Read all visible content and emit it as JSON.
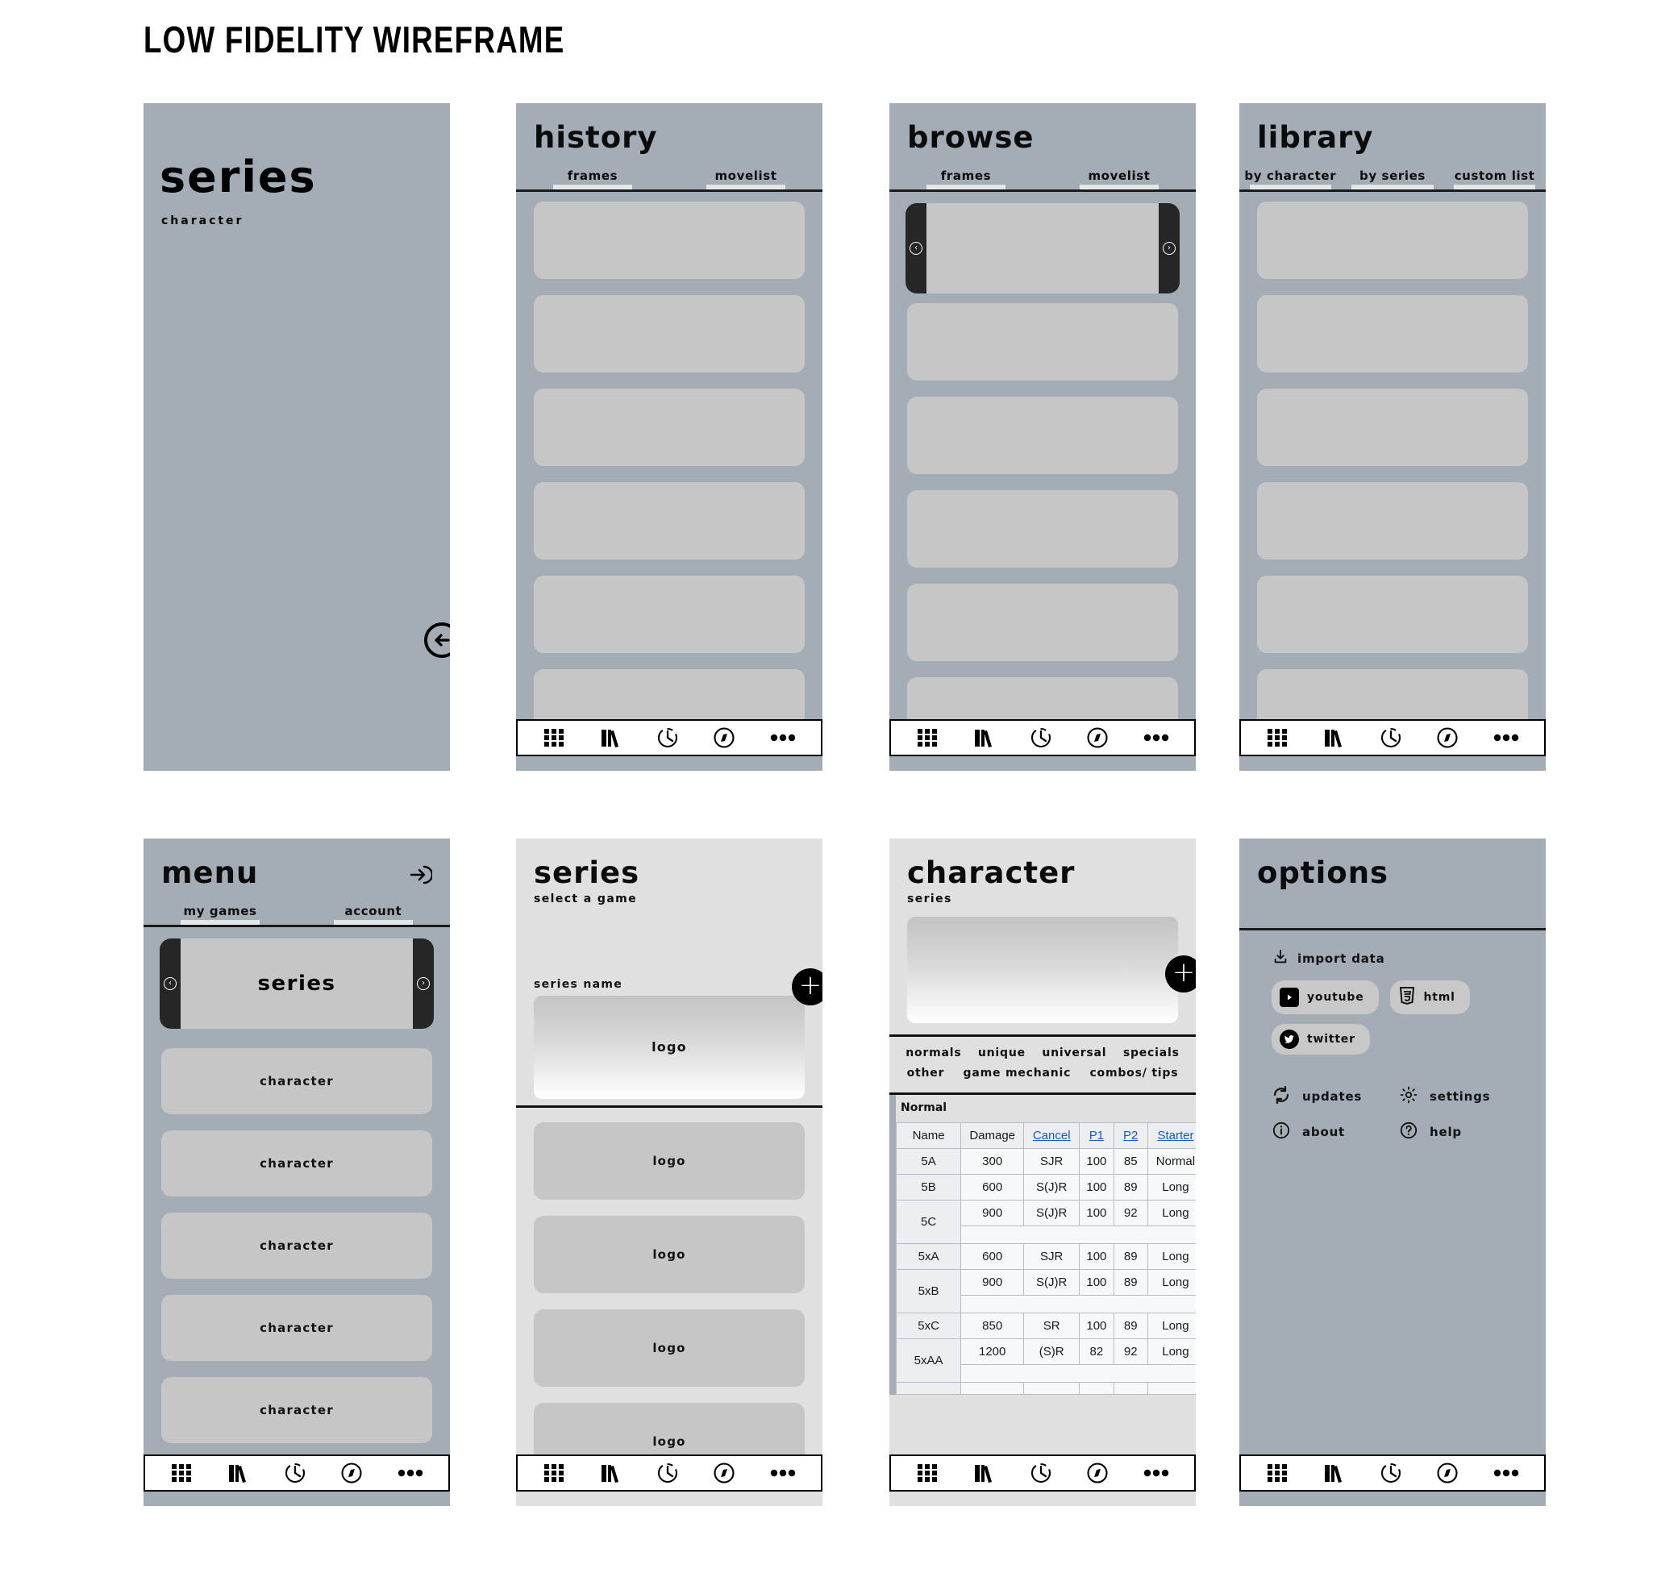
{
  "page": {
    "title": "LOW FIDELITY WIREFRAME"
  },
  "colors": {
    "frame_bg": "#a4acb6",
    "frame_bg_light": "#e0e0e0",
    "card": "#c6c6c6",
    "accent_black": "#000000",
    "link_blue": "#1a56d6"
  },
  "nav": {
    "items": [
      {
        "name": "grid-icon",
        "label": "grid"
      },
      {
        "name": "library-icon",
        "label": "library"
      },
      {
        "name": "clock-icon",
        "label": "history"
      },
      {
        "name": "compass-icon",
        "label": "browse"
      },
      {
        "name": "more-icon",
        "label": "more"
      }
    ]
  },
  "screens": {
    "series_splash": {
      "title": "series",
      "subtitle": "character",
      "back_icon": "back-arrow-icon"
    },
    "history": {
      "title": "history",
      "tabs": [
        {
          "label": "frames"
        },
        {
          "label": "movelist"
        }
      ],
      "cards": [
        "",
        "",
        "",
        "",
        "",
        ""
      ]
    },
    "browse": {
      "title": "browse",
      "tabs": [
        {
          "label": "frames"
        },
        {
          "label": "movelist"
        }
      ],
      "carousel": {
        "label": "",
        "prev": "‹",
        "next": "›"
      },
      "cards": [
        "",
        "",
        "",
        "",
        ""
      ]
    },
    "library": {
      "title": "library",
      "tabs": [
        {
          "label": "by character"
        },
        {
          "label": "by series"
        },
        {
          "label": "custom list"
        }
      ],
      "cards": [
        "",
        "",
        "",
        "",
        "",
        ""
      ]
    },
    "menu": {
      "title": "menu",
      "login_icon": "login-arrow-icon",
      "tabs": [
        {
          "label": "my games"
        },
        {
          "label": "account"
        }
      ],
      "carousel": {
        "label": "series",
        "prev": "‹",
        "next": "›"
      },
      "cards": [
        "character",
        "character",
        "character",
        "character",
        "character"
      ]
    },
    "series_select": {
      "title": "series",
      "subtitle": "select a game",
      "field_label": "series name",
      "fab": "+",
      "hero_logo": "logo",
      "cards": [
        "logo",
        "logo",
        "logo",
        "logo"
      ]
    },
    "character": {
      "title": "character",
      "subtitle": "series",
      "fab": "+",
      "filters_row1": [
        "normals",
        "unique",
        "universal",
        "specials"
      ],
      "filters_row2": [
        "other",
        "game mechanic",
        "combos/ tips"
      ],
      "table": {
        "caption": "Normal",
        "headers": [
          "Name",
          "Damage",
          "Cancel",
          "P1",
          "P2",
          "Starter"
        ],
        "header_links": [
          false,
          false,
          true,
          true,
          true,
          true
        ],
        "rows": [
          {
            "name": "5A",
            "damage": "300",
            "cancel": "SJR",
            "p1": "100",
            "p2": "85",
            "starter": "Normal",
            "blank": false
          },
          {
            "name": "5B",
            "damage": "600",
            "cancel": "S(J)R",
            "p1": "100",
            "p2": "89",
            "starter": "Long",
            "blank": false
          },
          {
            "name": "5C",
            "damage": "900",
            "cancel": "S(J)R",
            "p1": "100",
            "p2": "92",
            "starter": "Long",
            "blank": true
          },
          {
            "name": "5xA",
            "damage": "600",
            "cancel": "SJR",
            "p1": "100",
            "p2": "89",
            "starter": "Long",
            "blank": false
          },
          {
            "name": "5xB",
            "damage": "900",
            "cancel": "S(J)R",
            "p1": "100",
            "p2": "89",
            "starter": "Long",
            "blank": true
          },
          {
            "name": "5xC",
            "damage": "850",
            "cancel": "SR",
            "p1": "100",
            "p2": "89",
            "starter": "Long",
            "blank": false
          },
          {
            "name": "5xAA",
            "damage": "1200",
            "cancel": "(S)R",
            "p1": "82",
            "p2": "92",
            "starter": "Long",
            "blank": true
          }
        ]
      }
    },
    "options": {
      "title": "options",
      "import_label": "import data",
      "import_icon": "download-icon",
      "pills": [
        {
          "label": "youtube",
          "icon": "youtube-icon"
        },
        {
          "label": "html",
          "icon": "html5-icon"
        },
        {
          "label": "twitter",
          "icon": "twitter-icon"
        }
      ],
      "items": [
        {
          "label": "updates",
          "icon": "refresh-icon"
        },
        {
          "label": "settings",
          "icon": "gear-icon"
        },
        {
          "label": "about",
          "icon": "info-icon"
        },
        {
          "label": "help",
          "icon": "question-icon"
        }
      ]
    }
  }
}
